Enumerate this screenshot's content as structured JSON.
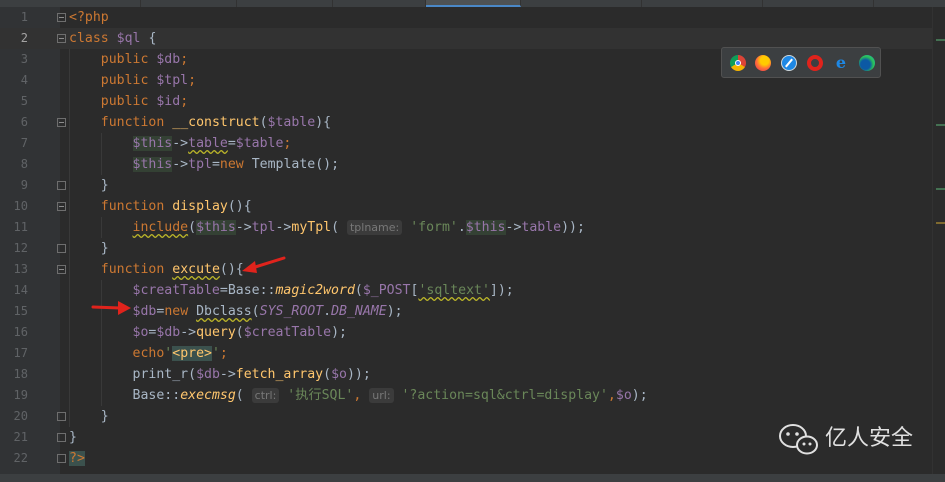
{
  "editor": {
    "line_numbers": [
      "1",
      "2",
      "3",
      "4",
      "5",
      "6",
      "7",
      "8",
      "9",
      "10",
      "11",
      "12",
      "13",
      "14",
      "15",
      "16",
      "17",
      "18",
      "19",
      "20",
      "21",
      "22"
    ],
    "current_line": "2",
    "lines": {
      "l1": {
        "open": "<?php"
      },
      "l2": {
        "kw": "class",
        "name": "$ql",
        "brace": "{"
      },
      "l3": {
        "kw": "public",
        "var": "$db",
        "semi": ";"
      },
      "l4": {
        "kw": "public",
        "var": "$tpl",
        "semi": ";"
      },
      "l5": {
        "kw": "public",
        "var": "$id",
        "semi": ";"
      },
      "l6": {
        "kw": "function",
        "fn": "__construct",
        "p1": "(",
        "var": "$table",
        "p2": "){"
      },
      "l7": {
        "this": "$this",
        "arrow": "->",
        "prop": "table",
        "eq": "=",
        "var": "$table",
        "semi": ";"
      },
      "l8": {
        "this": "$this",
        "arrow": "->",
        "prop": "tpl",
        "eq": "=",
        "kw": "new",
        "cls": "Template",
        "rest": "();"
      },
      "l9": {
        "brace": "}"
      },
      "l10": {
        "kw": "function",
        "fn": "display",
        "rest": "(){"
      },
      "l11": {
        "inc": "include",
        "p1": "(",
        "this1": "$this",
        "a1": "->",
        "prop1": "tpl",
        "a2": "->",
        "fn": "myTpl",
        "p2": "(",
        "hint": "tplname:",
        "str": "'form'",
        "dot": ".",
        "this2": "$this",
        "a3": "->",
        "prop2": "table",
        "end": "));"
      },
      "l12": {
        "brace": "}"
      },
      "l13": {
        "kw": "function",
        "fn": "excute",
        "rest": "(){"
      },
      "l14": {
        "var": "$creatTable",
        "eq": "=",
        "cls": "Base",
        "dc": "::",
        "fn": "magic2word",
        "p1": "(",
        "post": "$_POST",
        "b1": "[",
        "str": "'sqltext'",
        "end": "]);"
      },
      "l15": {
        "var": "$db",
        "eq": "=",
        "kw": "new",
        "cls": "Dbclass",
        "p1": "(",
        "c1": "SYS_ROOT",
        "dot": ".",
        "c2": "DB_NAME",
        "end": ");"
      },
      "l16": {
        "var": "$o",
        "eq": "=",
        "var2": "$db",
        "arrow": "->",
        "fn": "query",
        "p1": "(",
        "var3": "$creatTable",
        "end": ");"
      },
      "l17": {
        "kw": "echo",
        "q1": "'",
        "tag": "<pre>",
        "q2": "'",
        "semi": ";"
      },
      "l18": {
        "fn": "print_r",
        "p1": "(",
        "var": "$db",
        "arrow": "->",
        "fn2": "fetch_array",
        "p2": "(",
        "var2": "$o",
        "end": "));"
      },
      "l19": {
        "cls": "Base",
        "dc": "::",
        "fn": "execmsg",
        "p1": "(",
        "hint1": "ctrl:",
        "str1": "'执行SQL'",
        "comma1": ",",
        "hint2": "url:",
        "str2": "'?action=sql&ctrl=display'",
        "comma2": ",",
        "var": "$o",
        "end": ");"
      },
      "l20": {
        "brace": "}"
      },
      "l21": {
        "brace": "}"
      },
      "l22": {
        "close": "?>"
      }
    }
  },
  "browser_icons": [
    "chrome-icon",
    "firefox-icon",
    "safari-icon",
    "opera-icon",
    "ie-icon",
    "edge-icon"
  ],
  "watermark": {
    "text": "亿人安全"
  },
  "colors": {
    "background": "#2b2b2b",
    "keyword": "#cc7832",
    "variable": "#9876aa",
    "string": "#6a8759",
    "function": "#ffc66d",
    "text": "#a9b7c6",
    "arrow": "#e0231c"
  }
}
